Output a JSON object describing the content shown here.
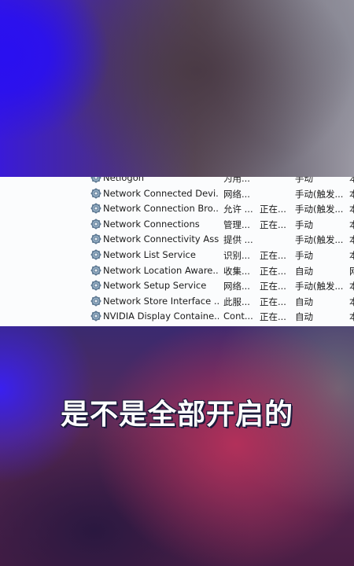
{
  "services": [
    {
      "name": "Netlogon",
      "desc": "为用...",
      "status": "",
      "startup": "手动",
      "logon": "本"
    },
    {
      "name": "Network Connected Devi...",
      "desc": "网络...",
      "status": "",
      "startup": "手动(触发...",
      "logon": "本"
    },
    {
      "name": "Network Connection Bro...",
      "desc": "允许 ...",
      "status": "正在...",
      "startup": "手动(触发...",
      "logon": "本"
    },
    {
      "name": "Network Connections",
      "desc": "管理...",
      "status": "正在...",
      "startup": "手动",
      "logon": "本"
    },
    {
      "name": "Network Connectivity Ass...",
      "desc": "提供 ...",
      "status": "",
      "startup": "手动(触发...",
      "logon": "本"
    },
    {
      "name": "Network List Service",
      "desc": "识别...",
      "status": "正在...",
      "startup": "手动",
      "logon": "本"
    },
    {
      "name": "Network Location Aware...",
      "desc": "收集...",
      "status": "正在...",
      "startup": "自动",
      "logon": "网"
    },
    {
      "name": "Network Setup Service",
      "desc": "网络...",
      "status": "正在...",
      "startup": "手动(触发...",
      "logon": "本"
    },
    {
      "name": "Network Store Interface ...",
      "desc": "此服...",
      "status": "正在...",
      "startup": "自动",
      "logon": "本"
    },
    {
      "name": "NVIDIA Display Containe...",
      "desc": "Cont...",
      "status": "正在...",
      "startup": "自动",
      "logon": "本"
    }
  ],
  "caption": "是不是全部开启的",
  "colors": {
    "panel_bg": "#fbfcfd",
    "text": "#1b1b1b",
    "accent_blue": "#2a10f0",
    "accent_pink": "#b2305a"
  },
  "icons": {
    "service": "gear-icon"
  }
}
